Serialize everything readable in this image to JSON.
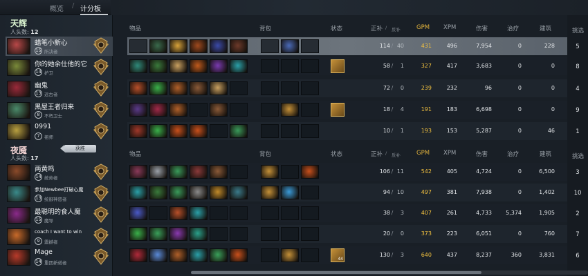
{
  "tabs": [
    {
      "label": "概览"
    },
    {
      "label": "计分板"
    }
  ],
  "radiant": {
    "title": "天辉",
    "kills_label": "人头数:",
    "kills": "12"
  },
  "dire": {
    "title": "夜魇",
    "kills_label": "人头数:",
    "kills": "17",
    "victory_badge": "获胜"
  },
  "headers": {
    "items": "物品",
    "backpack": "背包",
    "status": "状态",
    "lasthits": "正补",
    "denies": "反补",
    "slash": "/",
    "gpm": "GPM",
    "xpm": "XPM",
    "damage": "伤害",
    "heal": "治疗",
    "buildings": "建筑",
    "pick": "挑选"
  },
  "players": [
    {
      "name": "蜡笔小新心",
      "level": "15",
      "rank": "所决者",
      "lh": "114",
      "dn": "40",
      "gpm": "431",
      "xpm": "496",
      "dmg": "7,954",
      "heal": "0",
      "bld": "228",
      "pick": "5",
      "hero_color": "#b84848",
      "items": [
        "#2b2f33",
        "#3a6a4c",
        "#d7a23a",
        "#a04a1e",
        "#3b4aa8",
        "#6d3a2a"
      ],
      "bp": [
        "#2b2f33",
        "#4a6ab8",
        "#2b2f33"
      ],
      "neutral": ""
    },
    {
      "name": "你的她余仕他的它",
      "level": "14",
      "rank": "护卫",
      "lh": "58",
      "dn": "1",
      "gpm": "327",
      "xpm": "417",
      "dmg": "3,683",
      "heal": "0",
      "bld": "0",
      "pick": "8",
      "hero_color": "#7a8a3a",
      "items": [
        "#2f8a7a",
        "#3a7a3c",
        "#c9a060",
        "#c05a1c",
        "#7a3ab0",
        "#2aa0a8"
      ],
      "bp": [
        "#2b2f33",
        "#2b2f33",
        "#2b2f33"
      ],
      "neutral": "#c49038"
    },
    {
      "name": "幽鬼",
      "level": "13",
      "rank": "远古者",
      "lh": "72",
      "dn": "0",
      "gpm": "239",
      "xpm": "232",
      "dmg": "96",
      "heal": "0",
      "bld": "0",
      "pick": "4",
      "hero_color": "#9a2a3a",
      "items": [
        "#b8502a",
        "#3ab04a",
        "#b0602a",
        "#8a5a38",
        "#c9a060",
        "#2b2f33"
      ],
      "bp": [
        "#2b2f33",
        "#2b2f33",
        "#2b2f33"
      ],
      "neutral": ""
    },
    {
      "name": "黑屋王者归来",
      "level": "8",
      "rank": "不朽卫士",
      "lh": "18",
      "dn": "4",
      "gpm": "191",
      "xpm": "183",
      "dmg": "6,698",
      "heal": "0",
      "bld": "0",
      "pick": "9",
      "hero_color": "#4a8a6a",
      "items": [
        "#5a3a8a",
        "#a02a4a",
        "#b0602a",
        "#2b2f33",
        "#8a5a38",
        "#2b2f33"
      ],
      "bp": [
        "#2b2f33",
        "#c49038",
        "#2b2f33"
      ],
      "neutral": "#c49038"
    },
    {
      "name": "0991",
      "level": "7",
      "rank": "祖师",
      "lh": "10",
      "dn": "1",
      "gpm": "193",
      "xpm": "153",
      "dmg": "5,287",
      "heal": "0",
      "bld": "46",
      "pick": "1",
      "hero_color": "#b8a040",
      "items": [
        "#a0382a",
        "#3ab04a",
        "#c8501c",
        "#c8501c",
        "#2b2f33",
        "#3a9a5a"
      ],
      "bp": [
        "#2b2f33",
        "#2b2f33",
        "#2b2f33"
      ],
      "neutral": ""
    },
    {
      "name": "两黄鸣",
      "level": "14",
      "rank": "统帅者",
      "lh": "106",
      "dn": "11",
      "gpm": "542",
      "xpm": "405",
      "dmg": "4,724",
      "heal": "0",
      "bld": "6,500",
      "pick": "3",
      "hero_color": "#8a4a2a",
      "items": [
        "#8a3a5a",
        "#9aa0a8",
        "#3a9a5a",
        "#8a3a3a",
        "#8a5a38",
        "#2b2f33"
      ],
      "bp": [
        "#c49038",
        "#2b2f33",
        "#c8501c"
      ],
      "neutral": ""
    },
    {
      "name": "参加Newbee打破心魔",
      "level": "13",
      "rank": "统御神怒者",
      "lh": "94",
      "dn": "10",
      "gpm": "497",
      "xpm": "381",
      "dmg": "7,938",
      "heal": "0",
      "bld": "1,402",
      "pick": "10",
      "hero_color": "#3a8a8a",
      "items": [
        "#2aa0a8",
        "#3a7a3c",
        "#3a9a5a",
        "#8a8a8a",
        "#c08a2a",
        "#3a7a8a"
      ],
      "bp": [
        "#c49038",
        "#3a9ad8",
        "#2b2f33"
      ],
      "neutral": ""
    },
    {
      "name": "最聪明的食人魔",
      "level": "15",
      "rank": "魔导",
      "lh": "38",
      "dn": "3",
      "gpm": "407",
      "xpm": "261",
      "dmg": "4,733",
      "heal": "5,374",
      "bld": "1,905",
      "pick": "2",
      "hero_color": "#8a2a8a",
      "items": [
        "#4a5ac8",
        "#2b2f33",
        "#b8502a",
        "#2aa0a8",
        "#2b2f33",
        "#2b2f33"
      ],
      "bp": [
        "#2b2f33",
        "#2b2f33",
        "#2b2f33"
      ],
      "neutral": ""
    },
    {
      "name": "coach I want to win",
      "level": "9",
      "rank": "震撼者",
      "lh": "20",
      "dn": "0",
      "gpm": "373",
      "xpm": "223",
      "dmg": "6,051",
      "heal": "0",
      "bld": "760",
      "pick": "7",
      "hero_color": "#c86a2a",
      "items": [
        "#3ab04a",
        "#3aa05a",
        "#8a3ab0",
        "#2aa08a",
        "#2b2f33",
        "#2b2f33"
      ],
      "bp": [
        "#2b2f33",
        "#2b2f33",
        "#2b2f33"
      ],
      "neutral": ""
    },
    {
      "name": "Mage",
      "level": "14",
      "rank": "重团新诺者",
      "lh": "130",
      "dn": "3",
      "gpm": "640",
      "xpm": "437",
      "dmg": "8,237",
      "heal": "360",
      "bld": "3,831",
      "pick": "6",
      "hero_color": "#b83a2a",
      "items": [
        "#b02a3a",
        "#5a8ad8",
        "#b0602a",
        "#2aa0a8",
        "#3aa05a",
        "#c8501c"
      ],
      "bp": [
        "#2b2f33",
        "#c49038",
        "#2b2f33"
      ],
      "neutral": "#c49038",
      "neutral_charges": "44"
    }
  ]
}
